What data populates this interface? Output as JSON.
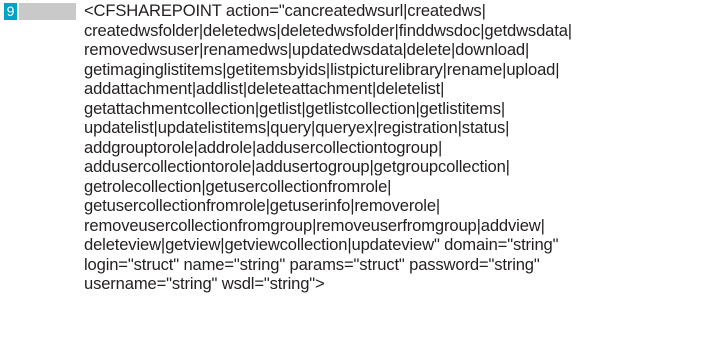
{
  "line_number": "9",
  "colors": {
    "line_number_background": "#00a3c4",
    "marker_bar": "#c9c9c9",
    "text": "#231f20"
  },
  "code_lines": [
    "<CFSHAREPOINT action=\"cancreatedwsurl|createdws|",
    "createdwsfolder|deletedws|deletedwsfolder|finddwsdoc|getdwsdata|",
    "removedwsuser|renamedws|updatedwsdata|delete|download|",
    "getimaginglistitems|getitemsbyids|listpicturelibrary|rename|upload|",
    "addattachment|addlist|deleteattachment|deletelist|",
    "getattachmentcollection|getlist|getlistcollection|getlistitems|",
    "updatelist|updatelistitems|query|queryex|registration|status|",
    "addgrouptorole|addrole|addusercollectiontogroup|",
    "addusercollectiontorole|addusertogroup|getgroupcollection|",
    "getrolecollection|getusercollectionfromrole|",
    "getusercollectionfromrole|getuserinfo|removerole|",
    "removeusercollectionfromgroup|removeuserfromgroup|addview|",
    "deleteview|getview|getviewcollection|updateview\" domain=\"string\"",
    "login=\"struct\" name=\"string\" params=\"struct\" password=\"string\"",
    "username=\"string\" wsdl=\"string\">"
  ]
}
